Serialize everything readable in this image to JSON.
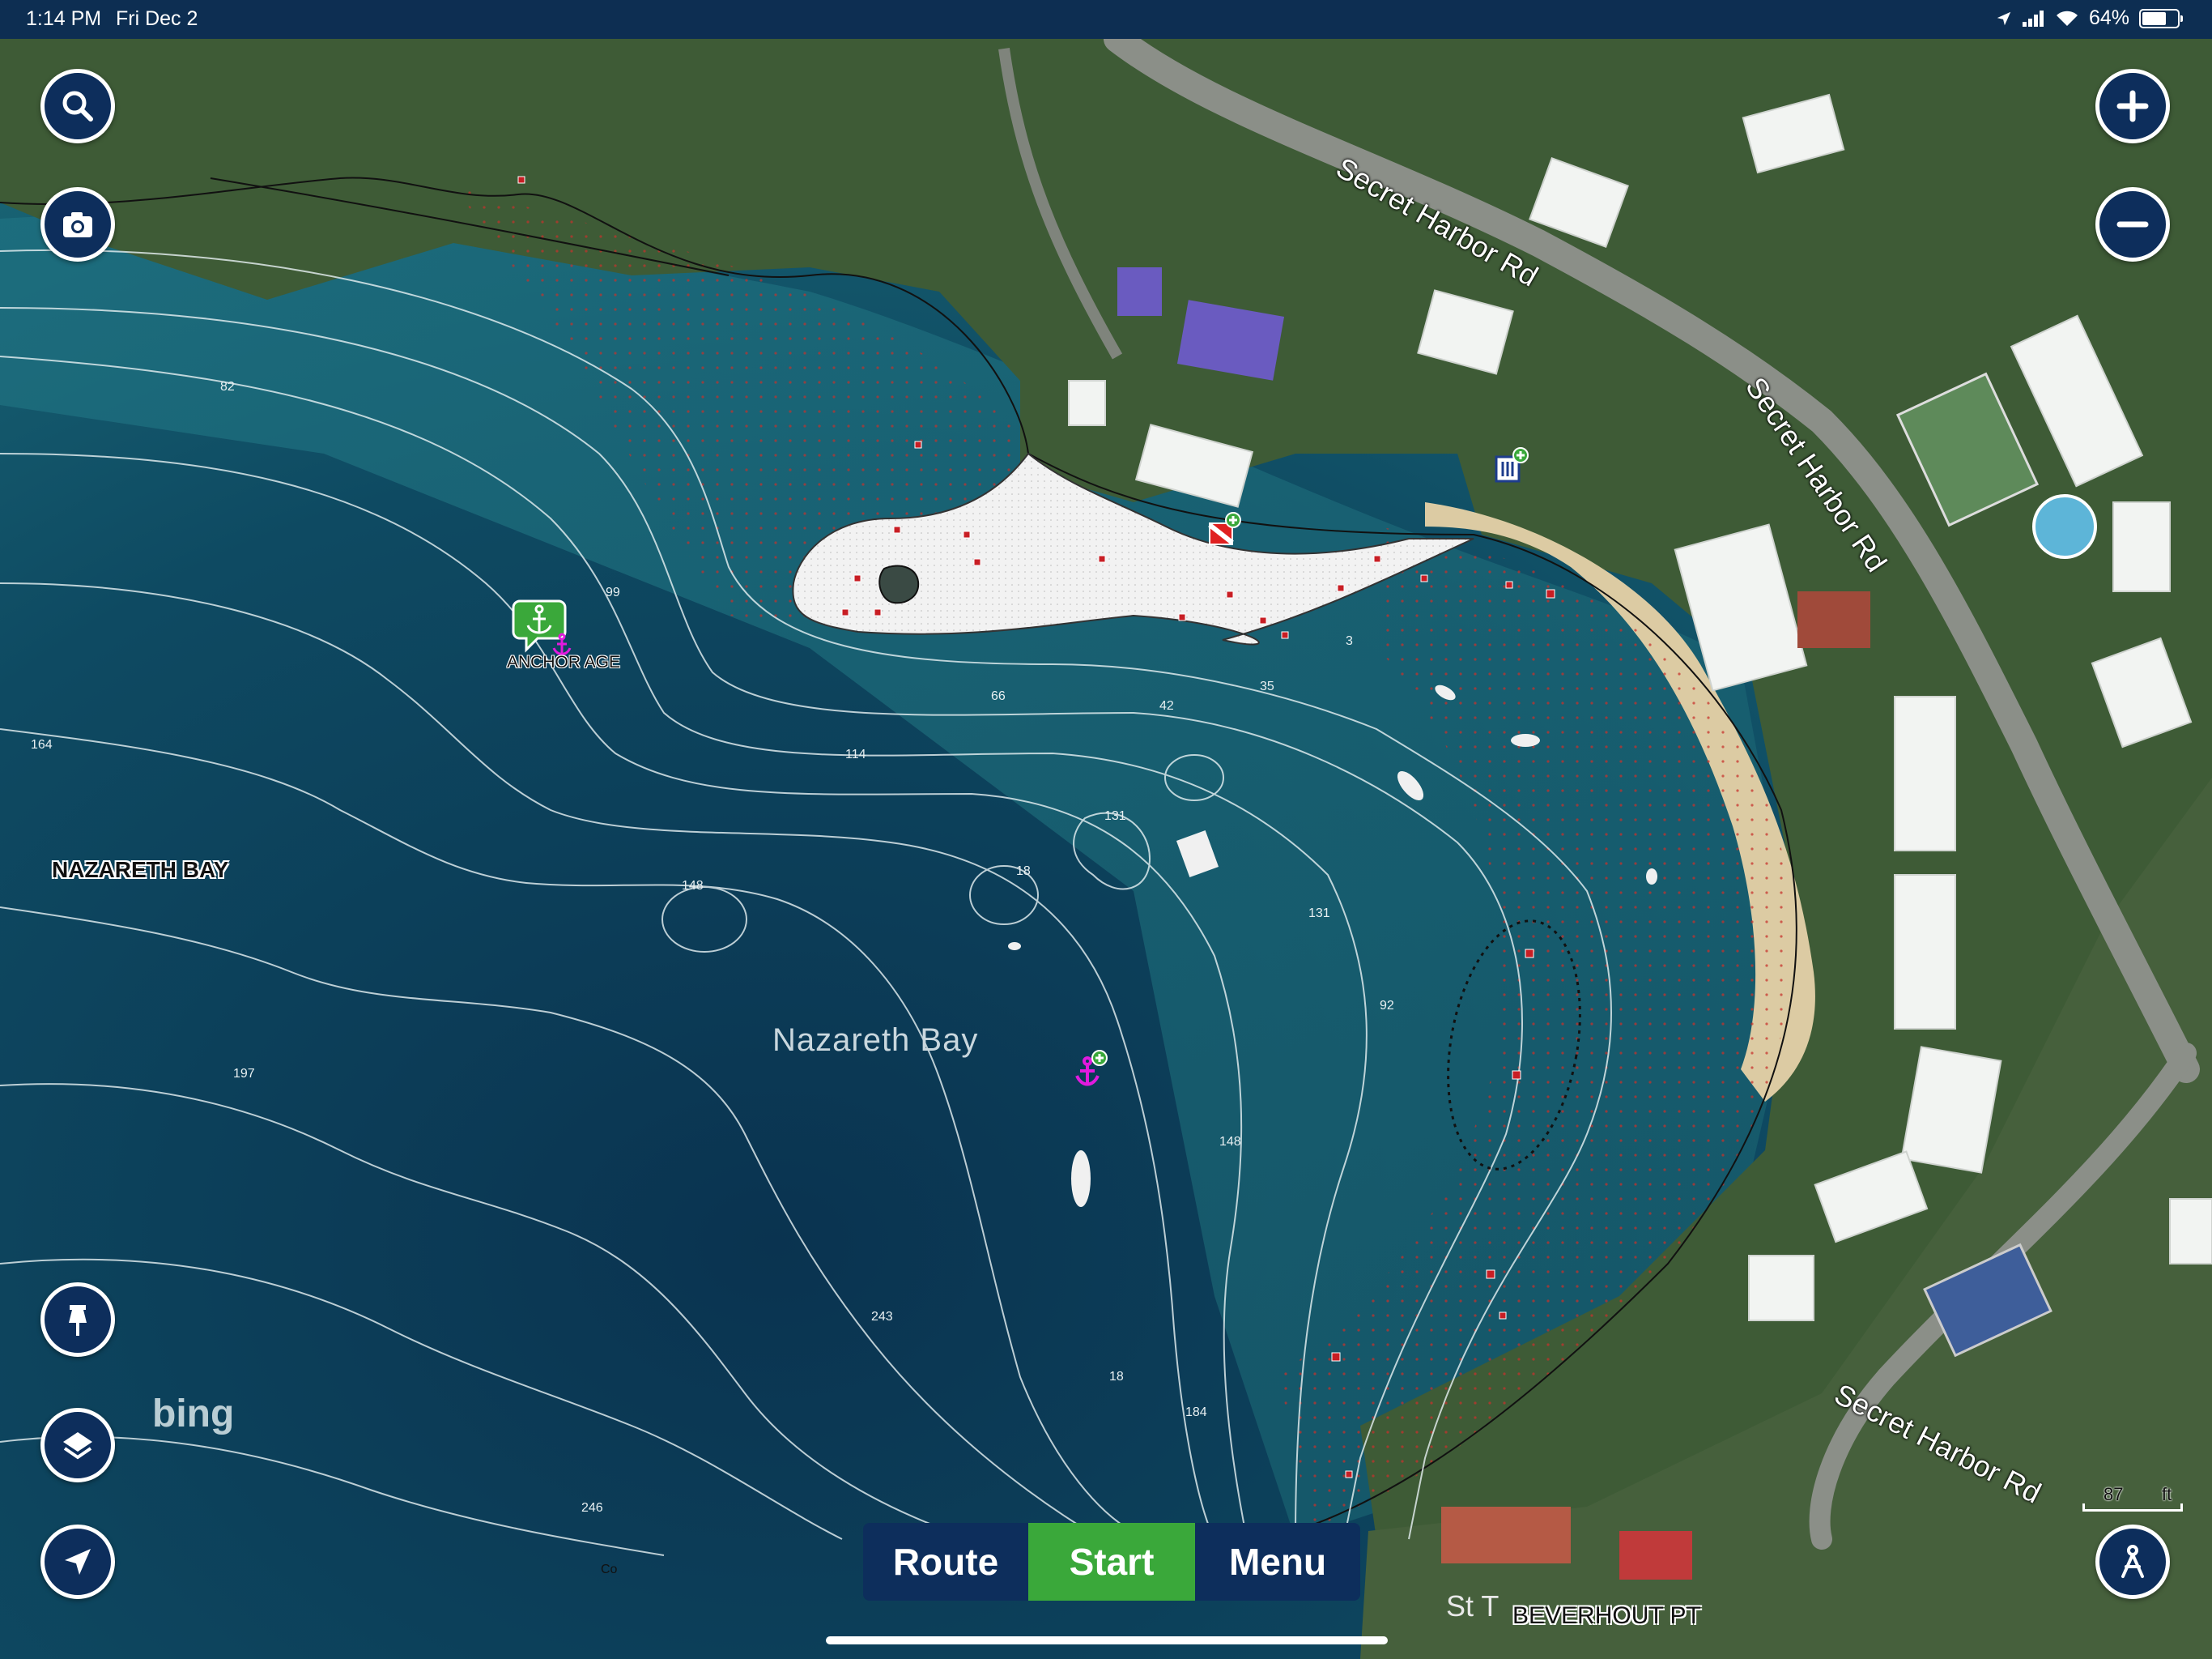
{
  "status_bar": {
    "time": "1:14 PM",
    "date": "Fri Dec 2",
    "battery": "64%",
    "battery_level": 0.64
  },
  "map": {
    "labels": {
      "nazareth_bay_upper": "NAZARETH BAY",
      "nazareth_bay": "Nazareth Bay",
      "anchorage": "ANCHOR AGE",
      "beverhout_pt": "BEVERHOUT PT",
      "st_partial": "St T",
      "bing": "bing"
    },
    "roads": [
      "Secret Harbor Rd",
      "Secret Harbor Rd",
      "Secret Harbor Rd"
    ],
    "depth_soundings": [
      "82",
      "99",
      "164",
      "66",
      "42",
      "35",
      "3",
      "114",
      "131",
      "148",
      "18",
      "131",
      "197",
      "92",
      "148",
      "243",
      "18",
      "184",
      "246",
      "Co"
    ],
    "scale": {
      "value": "87",
      "unit": "ft"
    },
    "colors": {
      "water_deep": "#0b3f5a",
      "water_shallow": "#1d6f7e",
      "land": "#3d5a35",
      "beach": "#e0d2b0",
      "sand_area": "#eeeeee",
      "marker_red": "#d0202a",
      "anchor_magenta": "#e21adf",
      "bubble_green": "#3aa83a"
    }
  },
  "controls": {
    "left": [
      "search-icon",
      "camera-icon",
      "pin-icon",
      "layers-icon",
      "location-arrow-icon"
    ],
    "right": [
      "plus-icon",
      "minus-icon",
      "compass-person-icon"
    ]
  },
  "bottom_bar": {
    "route": "Route",
    "start": "Start",
    "menu": "Menu"
  }
}
